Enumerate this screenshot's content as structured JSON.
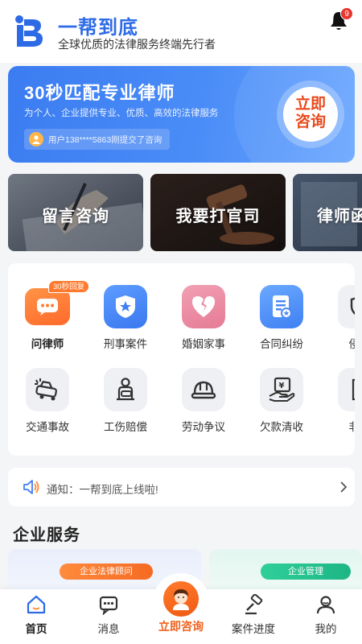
{
  "header": {
    "app_name": "一帮到底",
    "slogan": "全球优质的法律服务终端先行者",
    "notification_count": "9"
  },
  "hero": {
    "title": "30秒匹配专业律师",
    "subtitle": "为个人、企业提供专业、优质、高效的法律服务",
    "notice": "用户138****5863刚提交了咨询",
    "button_line1": "立即",
    "button_line2": "咨询"
  },
  "category_cards": [
    {
      "label": "留言咨询"
    },
    {
      "label": "我要打官司"
    },
    {
      "label": "律师函"
    }
  ],
  "services": {
    "row1": [
      {
        "label": "问律师",
        "badge": "30秒回复",
        "icon": "chat-bubble-icon"
      },
      {
        "label": "刑事案件",
        "icon": "shield-star-icon"
      },
      {
        "label": "婚姻家事",
        "icon": "broken-heart-icon"
      },
      {
        "label": "合同纠纷",
        "icon": "contract-icon"
      },
      {
        "label": "侵权",
        "icon": "infringement-icon"
      }
    ],
    "row2": [
      {
        "label": "交通事故",
        "icon": "car-crash-icon"
      },
      {
        "label": "工伤赔偿",
        "icon": "injured-worker-icon"
      },
      {
        "label": "劳动争议",
        "icon": "hard-hat-icon"
      },
      {
        "label": "欠款清收",
        "icon": "money-hand-icon"
      },
      {
        "label": "非讼",
        "icon": "document-icon"
      }
    ]
  },
  "notice_bar": {
    "text": "通知：一帮到底上线啦!"
  },
  "enterprise": {
    "title": "企业服务",
    "cards": [
      {
        "tag": "企业法律顾问"
      },
      {
        "tag": "企业管理"
      }
    ]
  },
  "nav": {
    "items": [
      {
        "label": "首页"
      },
      {
        "label": "消息"
      },
      {
        "label": "立即咨询"
      },
      {
        "label": "案件进度"
      },
      {
        "label": "我的"
      }
    ]
  },
  "colors": {
    "brand_blue": "#2d6be6",
    "accent_orange": "#f0601a",
    "badge_red": "#e8362f"
  }
}
